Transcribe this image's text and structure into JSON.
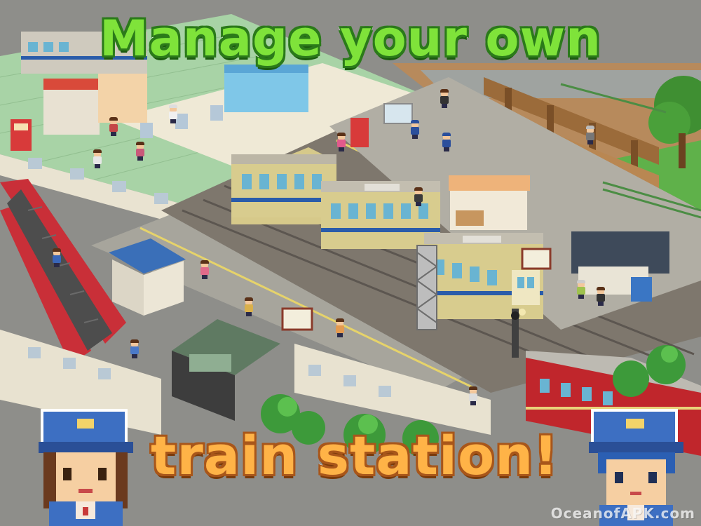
{
  "headline": {
    "line1": "Manage your own",
    "line2": "train station!"
  },
  "watermark": "OceanofAPK.com",
  "colors": {
    "headline_top_fill": "#7fe33a",
    "headline_bottom_fill": "#ffb347",
    "train_body": "#d6c98a",
    "train_stripe": "#2a5caa",
    "train_red": "#c0262c",
    "platform": "#c9c2ad",
    "rooftop_green": "#9fd5a0",
    "grass": "#5fb14a"
  }
}
